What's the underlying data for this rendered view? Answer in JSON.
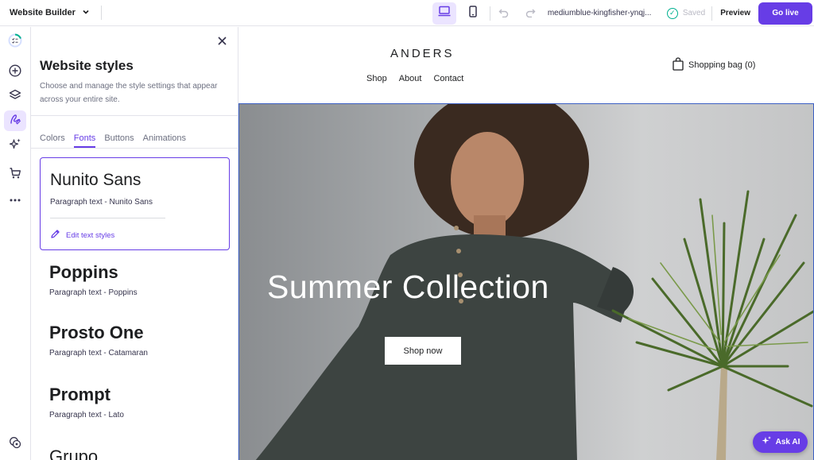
{
  "topbar": {
    "app_title": "Website Builder",
    "domain": "mediumblue-kingfisher-ynqj...",
    "saved_label": "Saved",
    "preview_label": "Preview",
    "go_live_label": "Go live"
  },
  "panel": {
    "title": "Website styles",
    "description": "Choose and manage the style settings that appear across your entire site.",
    "tabs": [
      {
        "label": "Colors",
        "active": false
      },
      {
        "label": "Fonts",
        "active": true
      },
      {
        "label": "Buttons",
        "active": false
      },
      {
        "label": "Animations",
        "active": false
      }
    ],
    "selected_font": {
      "name": "Nunito Sans",
      "paragraph": "Paragraph text - Nunito Sans",
      "edit_label": "Edit text styles"
    },
    "font_options": [
      {
        "name": "Poppins",
        "paragraph": "Paragraph text - Poppins"
      },
      {
        "name": "Prosto One",
        "paragraph": "Paragraph text - Catamaran"
      },
      {
        "name": "Prompt",
        "paragraph": "Paragraph text - Lato"
      },
      {
        "name": "Grupo",
        "paragraph": ""
      }
    ]
  },
  "site": {
    "logo": "ANDERS",
    "nav": [
      "Shop",
      "About",
      "Contact"
    ],
    "bag_label": "Shopping bag (0)",
    "hero_title": "Summer Collection",
    "hero_button": "Shop now"
  },
  "ask_ai_label": "Ask AI",
  "colors": {
    "accent": "#673de6",
    "accent_light": "#ebe4ff",
    "saved_green": "#00b090",
    "selection_blue": "#3b5fc4"
  },
  "icons": {
    "rail": [
      "onboarding-progress-icon",
      "add-icon",
      "layers-icon",
      "styles-icon",
      "ai-sparkle-icon",
      "cart-icon",
      "more-icon",
      "settings-icon"
    ],
    "topbar": [
      "chevron-down-icon",
      "desktop-icon",
      "mobile-icon",
      "undo-icon",
      "redo-icon",
      "check-circle-icon"
    ]
  }
}
